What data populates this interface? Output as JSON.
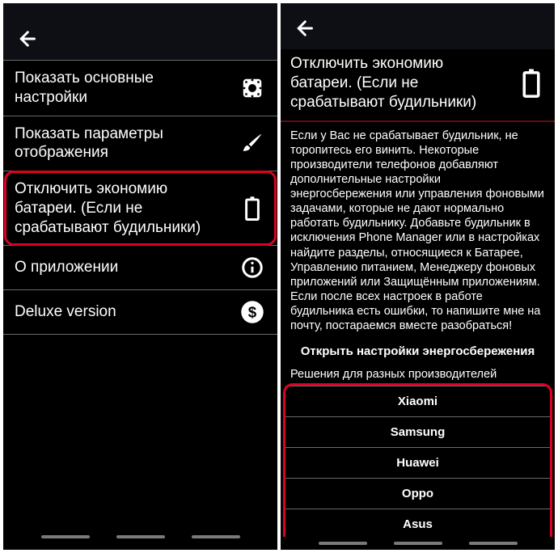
{
  "left": {
    "items": [
      {
        "label": "Показать основные настройки",
        "icon": "gear"
      },
      {
        "label": "Показать параметры отображения",
        "icon": "brush"
      },
      {
        "label": "Отключить экономию батареи. (Если не срабатывают будильники)",
        "icon": "battery"
      },
      {
        "label": "О приложении",
        "icon": "info"
      },
      {
        "label": "Deluxe version",
        "icon": "dollar"
      }
    ]
  },
  "right": {
    "title": "Отключить экономию батареи. (Если не срабатывают будильники)",
    "body": "Если у Вас не срабатывает будильник, не торопитесь его винить. Некоторые производители телефонов добавляют дополнительные настройки энергосбережения или управления фоновыми задачами, которые не дают нормально работать будильнику. Добавьте будильник в исключения Phone Manager или в настройках найдите разделы, относящиеся к Батарее, Управлению питанием, Менеджеру фоновых приложений или Защищённым приложениям.\nЕсли после всех настроек в работе будильника есть ошибки, то напишите мне на почту, постараемся вместе разобраться!",
    "open_link": "Открыть настройки энергосбережения",
    "solutions_label": "Решения для разных производителей",
    "vendors": [
      "Xiaomi",
      "Samsung",
      "Huawei",
      "Oppo",
      "Asus"
    ]
  }
}
